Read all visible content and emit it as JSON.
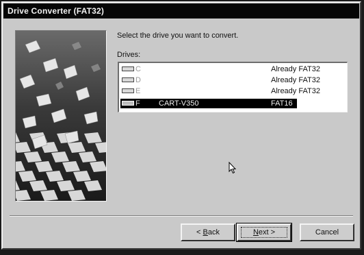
{
  "window": {
    "title": "Drive Converter (FAT32)"
  },
  "main": {
    "instruction": "Select the drive you want to convert.",
    "drives_label": "Drives:",
    "drives": [
      {
        "letter": "C",
        "label": "",
        "status": "Already FAT32",
        "selected": false
      },
      {
        "letter": "D",
        "label": "",
        "status": "Already FAT32",
        "selected": false
      },
      {
        "letter": "E",
        "label": "",
        "status": "Already FAT32",
        "selected": false
      },
      {
        "letter": "F",
        "label": "CART-V350",
        "status": "FAT16",
        "selected": true
      }
    ]
  },
  "buttons": {
    "back_prefix": "< ",
    "back_mnemonic": "B",
    "back_rest": "ack",
    "next_mnemonic": "N",
    "next_rest": "ext >",
    "cancel": "Cancel"
  },
  "icons": {
    "drive": "hard-drive-icon",
    "cursor": "mouse-pointer-icon"
  },
  "colors": {
    "titlebar": "#060606",
    "dialog_bg": "#c9c9c9",
    "selection": "#000000"
  }
}
